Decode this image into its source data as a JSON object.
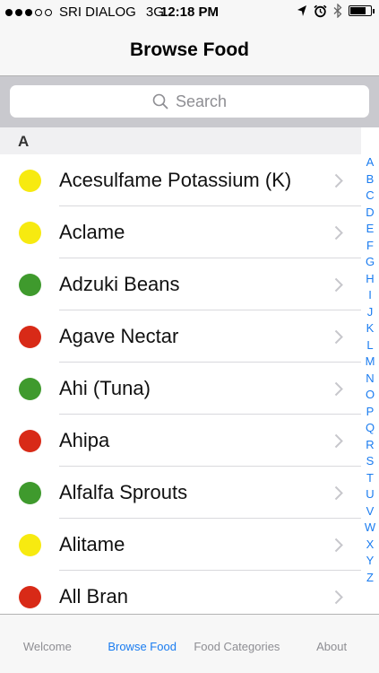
{
  "status_bar": {
    "signal_full": 3,
    "signal_empty": 2,
    "carrier": "SRI DIALOG",
    "network": "3G",
    "time": "12:18 PM",
    "battery_level": 0.75
  },
  "nav": {
    "title": "Browse Food"
  },
  "search": {
    "placeholder": "Search"
  },
  "section": {
    "title": "A"
  },
  "foods": [
    {
      "name": "Acesulfame Potassium (K)",
      "color": "#f7ea10"
    },
    {
      "name": "Aclame",
      "color": "#f7ea10"
    },
    {
      "name": "Adzuki Beans",
      "color": "#3f9a2d"
    },
    {
      "name": "Agave Nectar",
      "color": "#d82a17"
    },
    {
      "name": "Ahi (Tuna)",
      "color": "#3f9a2d"
    },
    {
      "name": "Ahipa",
      "color": "#d82a17"
    },
    {
      "name": "Alfalfa Sprouts",
      "color": "#3f9a2d"
    },
    {
      "name": "Alitame",
      "color": "#f7ea10"
    },
    {
      "name": "All Bran",
      "color": "#d82a17"
    }
  ],
  "index_letters": [
    "A",
    "B",
    "C",
    "D",
    "E",
    "F",
    "G",
    "H",
    "I",
    "J",
    "K",
    "L",
    "M",
    "N",
    "O",
    "P",
    "Q",
    "R",
    "S",
    "T",
    "U",
    "V",
    "W",
    "X",
    "Y",
    "Z"
  ],
  "tabs": [
    {
      "label": "Welcome",
      "active": false
    },
    {
      "label": "Browse Food",
      "active": true
    },
    {
      "label": "Food Categories",
      "active": false
    },
    {
      "label": "About",
      "active": false
    }
  ],
  "colors": {
    "accent": "#1a7cf0",
    "green": "#3f9a2d",
    "yellow": "#f7ea10",
    "red": "#d82a17"
  },
  "icons": {
    "status": [
      "location-arrow-icon",
      "alarm-icon",
      "bluetooth-icon",
      "battery-icon"
    ],
    "search": "search-icon",
    "row_chevron": "chevron-right-icon"
  }
}
